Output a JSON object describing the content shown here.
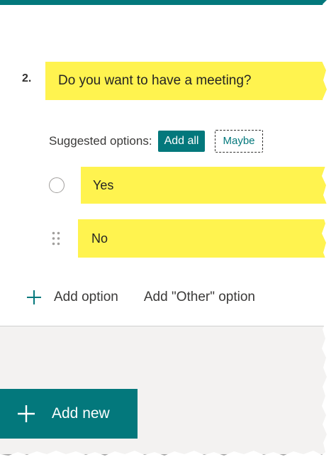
{
  "question": {
    "number": "2.",
    "title": "Do you want to have a meeting?"
  },
  "suggested": {
    "label": "Suggested options:",
    "add_all_label": "Add all",
    "maybe_label": "Maybe"
  },
  "options": [
    {
      "label": "Yes",
      "icon": "radio-circle-icon"
    },
    {
      "label": "No",
      "icon": "drag-handle-icon"
    }
  ],
  "actions": {
    "add_option_label": "Add option",
    "add_other_label": "Add \"Other\" option",
    "add_new_label": "Add new"
  },
  "colors": {
    "accent": "#03787c",
    "highlight": "#fff34f",
    "background": "#f3f2f1"
  }
}
